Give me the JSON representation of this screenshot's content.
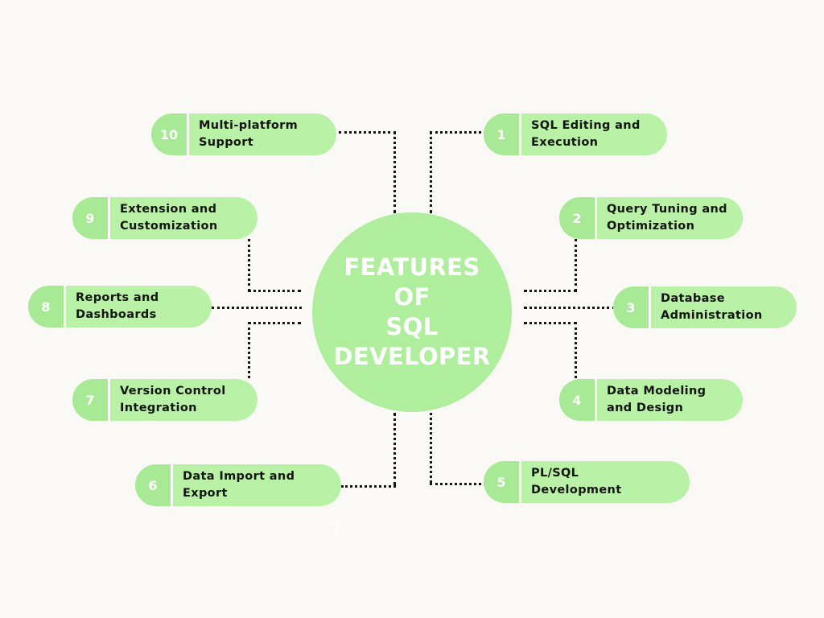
{
  "page": {
    "background_color": "#FAF9F6",
    "watermark": "7"
  },
  "hub": {
    "title": "FEATURES OF\nSQL\nDEVELOPER",
    "fill_color": "#AEEE9C",
    "text_color": "#FFFFFF"
  },
  "style": {
    "pill_body_color": "#B9F2A6",
    "pill_badge_color": "#A8E995",
    "pill_text_color": "#12140F",
    "badge_text_color": "#FFFFFF",
    "connector_color": "#16170F"
  },
  "features": [
    {
      "number": "1",
      "label": "SQL Editing and\nExecution",
      "side": "right"
    },
    {
      "number": "2",
      "label": "Query Tuning and\nOptimization",
      "side": "right"
    },
    {
      "number": "3",
      "label": "Database\nAdministration",
      "side": "right"
    },
    {
      "number": "4",
      "label": "Data Modeling\nand Design",
      "side": "right"
    },
    {
      "number": "5",
      "label": "PL/SQL\nDevelopment",
      "side": "right"
    },
    {
      "number": "6",
      "label": "Data Import and\nExport",
      "side": "left"
    },
    {
      "number": "7",
      "label": "Version Control\nIntegration",
      "side": "left"
    },
    {
      "number": "8",
      "label": "Reports and\nDashboards",
      "side": "left"
    },
    {
      "number": "9",
      "label": "Extension and\nCustomization",
      "side": "left"
    },
    {
      "number": "10",
      "label": "Multi-platform\nSupport",
      "side": "left"
    }
  ],
  "chart_data": {
    "type": "diagram",
    "diagram_kind": "mind-map",
    "title": "FEATURES OF SQL DEVELOPER",
    "center_node": "FEATURES OF SQL DEVELOPER",
    "node_count": 10,
    "nodes": [
      {
        "id": 1,
        "label": "SQL Editing and Execution",
        "position": "right-top"
      },
      {
        "id": 2,
        "label": "Query Tuning and Optimization",
        "position": "right-upper"
      },
      {
        "id": 3,
        "label": "Database Administration",
        "position": "right-middle"
      },
      {
        "id": 4,
        "label": "Data Modeling and Design",
        "position": "right-lower"
      },
      {
        "id": 5,
        "label": "PL/SQL Development",
        "position": "right-bottom"
      },
      {
        "id": 6,
        "label": "Data Import and Export",
        "position": "left-bottom"
      },
      {
        "id": 7,
        "label": "Version Control Integration",
        "position": "left-lower"
      },
      {
        "id": 8,
        "label": "Reports and Dashboards",
        "position": "left-middle"
      },
      {
        "id": 9,
        "label": "Extension and Customization",
        "position": "left-upper"
      },
      {
        "id": 10,
        "label": "Multi-platform Support",
        "position": "left-top"
      }
    ],
    "edges": [
      {
        "from": "center",
        "to": 1
      },
      {
        "from": "center",
        "to": 2
      },
      {
        "from": "center",
        "to": 3
      },
      {
        "from": "center",
        "to": 4
      },
      {
        "from": "center",
        "to": 5
      },
      {
        "from": "center",
        "to": 6
      },
      {
        "from": "center",
        "to": 7
      },
      {
        "from": "center",
        "to": 8
      },
      {
        "from": "center",
        "to": 9
      },
      {
        "from": "center",
        "to": 10
      }
    ],
    "edge_style": "dotted-elbow"
  }
}
